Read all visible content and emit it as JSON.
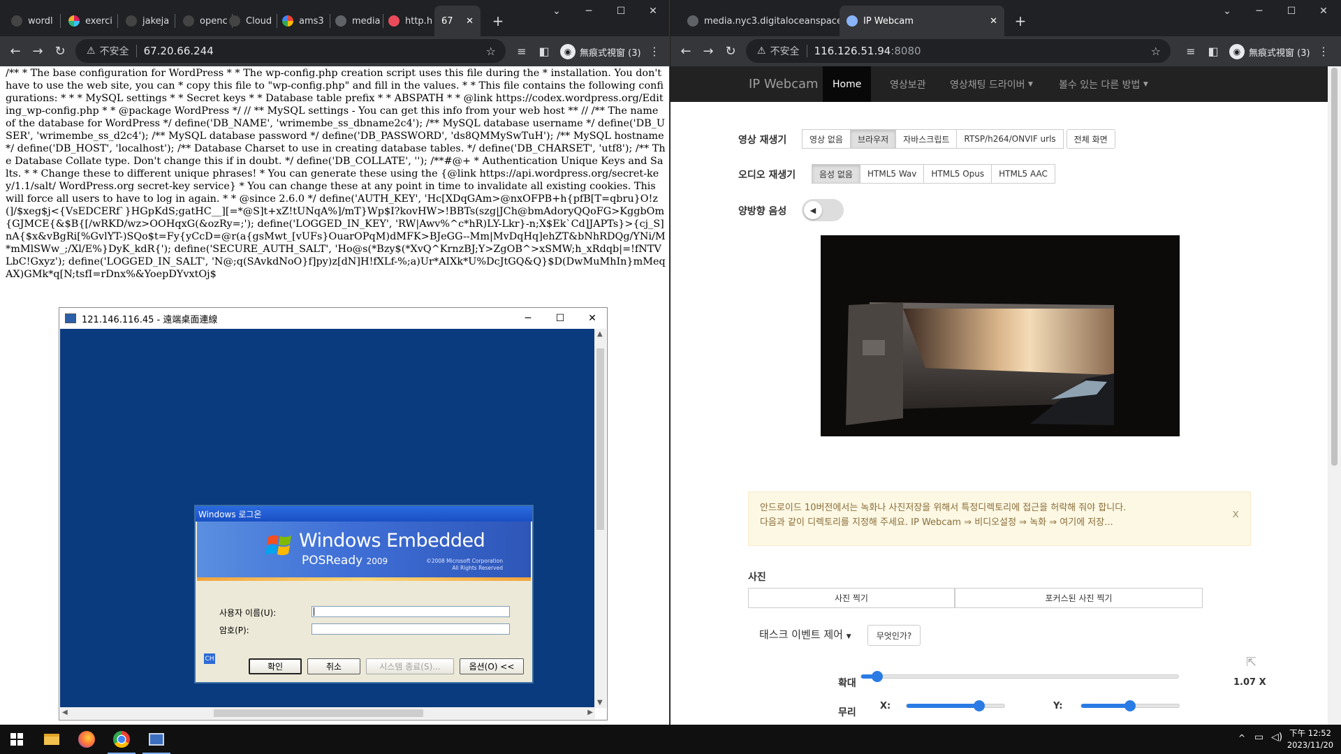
{
  "left_browser": {
    "tabs": [
      {
        "title": "wordl"
      },
      {
        "title": "exerci"
      },
      {
        "title": "jakeja"
      },
      {
        "title": "openc"
      },
      {
        "title": "Cloud"
      },
      {
        "title": "ams3"
      },
      {
        "title": "media"
      },
      {
        "title": "http.h"
      },
      {
        "title": "67"
      }
    ],
    "new_tab_label": "+",
    "insecure_label": "不安全",
    "url": "67.20.66.244",
    "incognito_label": "無痕式視窗 (3)",
    "page_text": "/** * The base configuration for WordPress * * The wp-config.php creation script uses this file during the * installation. You don't have to use the web site, you can * copy this file to \"wp-config.php\" and fill in the values. * * This file contains the following configurations: * * * MySQL settings * * Secret keys * * Database table prefix * * ABSPATH * * @link https://codex.wordpress.org/Editing_wp-config.php * * @package WordPress */ // ** MySQL settings - You can get this info from your web host ** // /** The name of the database for WordPress */ define('DB_NAME', 'wrimembe_ss_dbname2c4'); /** MySQL database username */ define('DB_USER', 'wrimembe_ss_d2c4'); /** MySQL database password */ define('DB_PASSWORD', 'ds8QMMySwTuH'); /** MySQL hostname */ define('DB_HOST', 'localhost'); /** Database Charset to use in creating database tables. */ define('DB_CHARSET', 'utf8'); /** The Database Collate type. Don't change this if in doubt. */ define('DB_COLLATE', ''); /**#@+ * Authentication Unique Keys and Salts. * * Change these to different unique phrases! * You can generate these using the {@link https://api.wordpress.org/secret-key/1.1/salt/ WordPress.org secret-key service} * You can change these at any point in time to invalidate all existing cookies. This will force all users to have to log in again. * * @since 2.6.0 */ define('AUTH_KEY', 'Hc[XDqGAm>@nxOFPB+h{pfB[T=qbru}O!z(]/$xeg$j<{VsEDCERf`}HGpKdS;gatHC__][=*@S]t+xZ!tUNqA%]/mT}Wp$I?kovHW>!BBTs(szg|JCh@bmAdoryQQoFG>KggbOm{GJMCE{&$B{[/wRKD/wz>OOHqxG(&ozRy=;'); define('LOGGED_IN_KEY', 'RW|Awv%^c*hR)LY-Lkr}-n;X$Ek`Cd]JAPTs}>{cj_S]nA{$x&vBgRi[%GvlYT-)SQo$t=Fy{yCcD=@r(a{gsMwt_[vUFs}OuarOPqM)dMFK>BJeGG--Mm|MvDqHq]ehZT&bNhRDQg/YNi/M*mMlSWw_;/Xl/E%}DyK_kdR{'); define('SECURE_AUTH_SALT', 'Ho@s(*Bzy$(*XvQ^KrnzBJ;Y>ZgOB^>xSMW;h_xRdqb|=!fNTVLbC!Gxyz'); define('LOGGED_IN_SALT', 'N@;q(SAvkdNoO}f]py)z[dN]H!fXLf-%;a)Ur*AIXk*U%DcJtGQ&Q}$D(DwMuMhIn}mMeqAX)GMk*q[N;tsfI=rDnx%&YoepDYvxtOj$"
  },
  "rdp": {
    "title": "121.146.116.45 - 遠端桌面連線",
    "logon": {
      "caption": "Windows 로그온",
      "brand_main": "Windows Embedded",
      "brand_sub": "POSReady",
      "brand_year": "2009",
      "copyright_1": "©2008 Microsoft Corporation",
      "copyright_2": "All Rights Reserved",
      "username_label": "사용자 이름(U):",
      "password_label": "암호(P):",
      "lang_indicator": "CH",
      "btn_ok": "확인",
      "btn_cancel": "취소",
      "btn_shutdown": "시스템 종료(S)...",
      "btn_options": "옵션(O) <<"
    }
  },
  "right_browser": {
    "tabs": [
      {
        "title": "media.nyc3.digitaloceanspaces"
      },
      {
        "title": "IP Webcam"
      }
    ],
    "new_tab_label": "+",
    "insecure_label": "不安全",
    "url_host": "116.126.51.94",
    "url_port": ":8080",
    "incognito_label": "無痕式視窗 (3)"
  },
  "ipwebcam": {
    "brand": "IP Webcam",
    "nav": [
      {
        "label": "Home"
      },
      {
        "label": "영상보관"
      },
      {
        "label": "영상채팅 드라이버"
      },
      {
        "label": "볼수 있는 다른 방법"
      }
    ],
    "video_player_label": "영상 재생기",
    "video_options": [
      "영상 없음",
      "브라우저",
      "자바스크립트",
      "RTSP/h264/ONVIF urls"
    ],
    "fullscreen_label": "전체 화면",
    "audio_player_label": "오디오 재생기",
    "audio_options": [
      "음성 없음",
      "HTML5 Wav",
      "HTML5 Opus",
      "HTML5 AAC"
    ],
    "twoway_audio_label": "양방향 음성",
    "alert_line1": "안드로이드 10버전에서는 녹화나 사진저장을 위해서 특정디렉토리에 접근을 허락해 줘야 합니다.",
    "alert_line2": "다음과 같이 디렉토리를 지정해 주세요. IP Webcam ⇒ 비디오설정 ⇒ 녹화 ⇒ 여기에 저장...",
    "alert_close": "x",
    "photo_section": "사진",
    "take_photo": "사진 찍기",
    "take_focused_photo": "포커스된 사진 찍기",
    "task_event_label": "태스크 이벤트 제어",
    "what_is_it": "무엇인가?",
    "zoom_label": "확대",
    "zoom_value": "1.07 X",
    "zoom_level": 0.05,
    "crop_label": "무리",
    "crop_x_label": "X:",
    "crop_y_label": "Y:",
    "crop_x_level": 0.74,
    "crop_y_level": 0.5
  },
  "taskbar": {
    "clock_time": "下午 12:52",
    "clock_date": "2023/11/20",
    "tray_arrow": "^"
  }
}
